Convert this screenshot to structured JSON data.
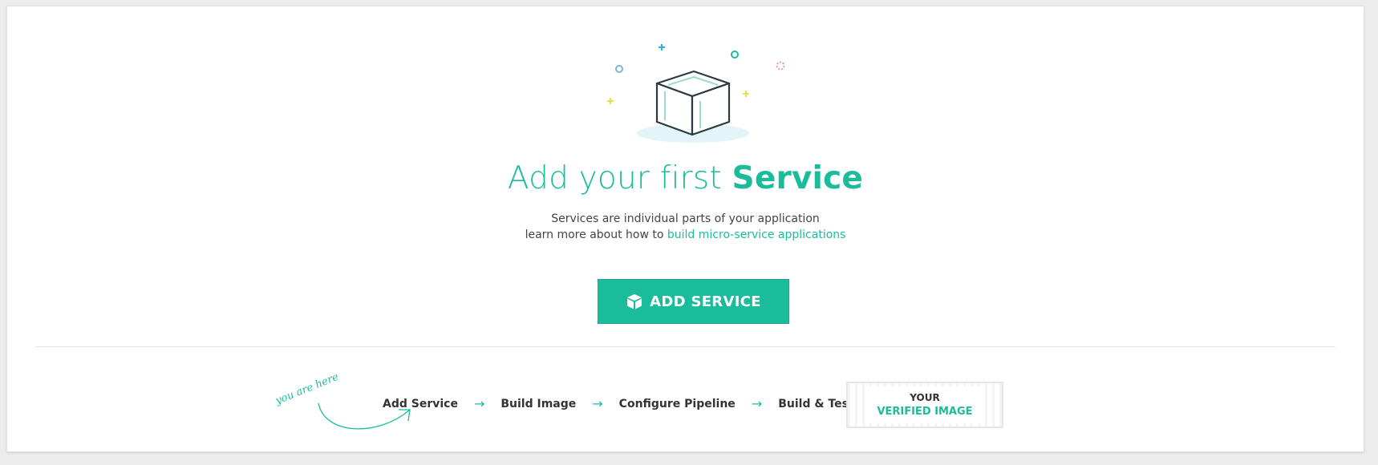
{
  "heading": {
    "prefix": "Add your first ",
    "emphasis": "Service"
  },
  "description": {
    "line1": "Services are individual parts of your application",
    "line2_prefix": "learn more about how to ",
    "link": "build micro-service applications"
  },
  "add_button": {
    "icon": "box-icon",
    "label": "ADD SERVICE"
  },
  "workflow": {
    "hint": "you are here",
    "steps": [
      "Add Service",
      "Build Image",
      "Configure Pipeline",
      "Build & Test"
    ],
    "arrow": "→",
    "final": {
      "line1": "YOUR",
      "line2": "VERIFIED IMAGE"
    }
  },
  "colors": {
    "accent": "#1bbc9b",
    "background": "#ececec",
    "text": "#333333"
  }
}
